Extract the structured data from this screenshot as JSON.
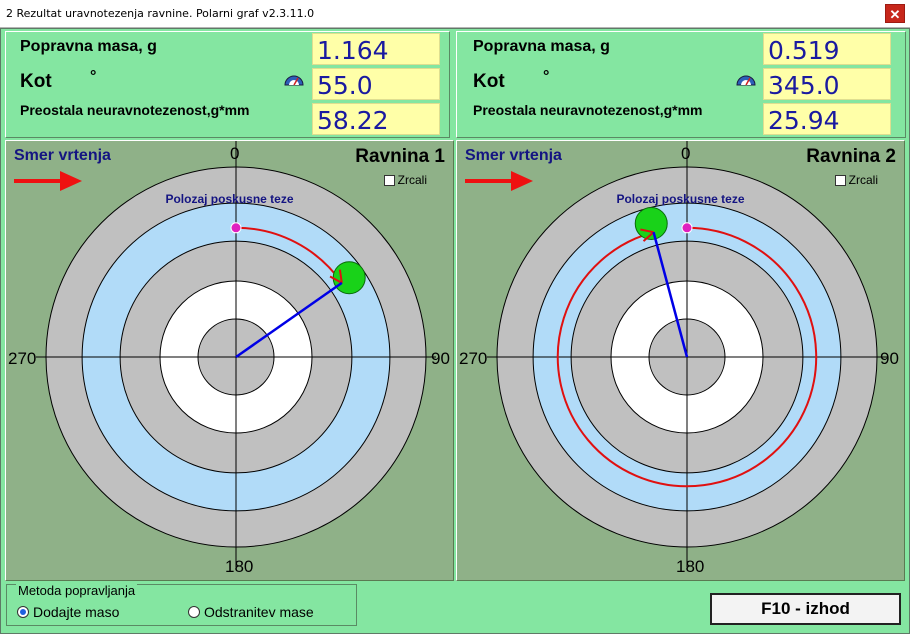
{
  "window": {
    "title": "2 Rezultat uravnotezenja ravnine. Polarni graf v2.3.11.0",
    "close_glyph": "✕"
  },
  "planes": [
    {
      "labels": {
        "mass": "Popravna masa, g",
        "angle": "Kot",
        "degree": "°",
        "residual": "Preostala neuravnotezenost,g*mm"
      },
      "mass_value": "1.164",
      "angle_value": "55.0",
      "residual_value": "58.22",
      "direction_label": "Smer vrtenja",
      "plane_name": "Ravnina 1",
      "mirror_label": "Zrcali",
      "mirror_checked": false,
      "trial_label": "Polozaj poskusne teze",
      "axis": {
        "top": "0",
        "right": "90",
        "bottom": "180",
        "left": "270"
      },
      "correction_angle_deg": 55,
      "correction_magnitude": 0.67,
      "trial_angle_deg": 0
    },
    {
      "labels": {
        "mass": "Popravna masa, g",
        "angle": "Kot",
        "degree": "°",
        "residual": "Preostala neuravnotezenost,g*mm"
      },
      "mass_value": "0.519",
      "angle_value": "345.0",
      "residual_value": "25.94",
      "direction_label": "Smer vrtenja",
      "plane_name": "Ravnina 2",
      "mirror_label": "Zrcali",
      "mirror_checked": false,
      "trial_label": "Polozaj poskusne teze",
      "axis": {
        "top": "0",
        "right": "90",
        "bottom": "180",
        "left": "270"
      },
      "correction_angle_deg": 345,
      "correction_magnitude": 0.67,
      "trial_angle_deg": 0
    }
  ],
  "method": {
    "legend": "Metoda popravljanja",
    "option_add": "Dodajte maso",
    "option_remove": "Odstranitev mase",
    "selected": "add"
  },
  "exit_button": "F10 - izhod",
  "icons": {
    "arrow": "rotation-direction-arrow-icon",
    "gauge": "protractor-icon"
  },
  "colors": {
    "background": "#84e6a1",
    "value_box": "#ffffa8",
    "value_text": "#1a1aa0",
    "plot_bg": "#8fb188",
    "ring_gray": "#c0c0c0",
    "ring_blue": "#b1dbf8",
    "ring_white": "#ffffff",
    "vector": "#0000e6",
    "arc": "#e01010",
    "weight": "#19d219",
    "trial_marker": "#e020c0"
  }
}
